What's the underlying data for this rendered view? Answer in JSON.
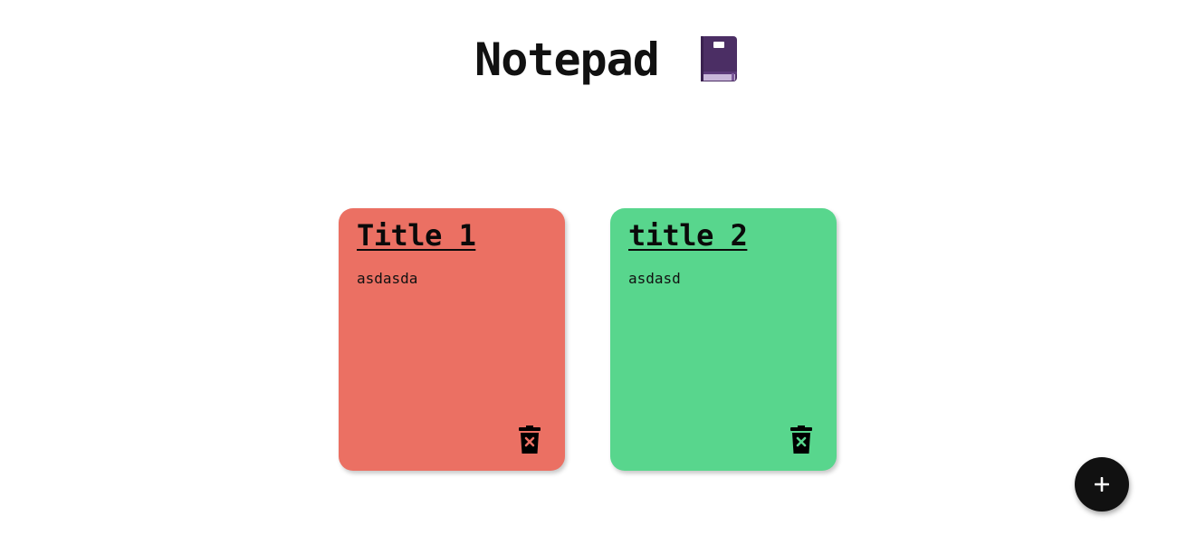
{
  "header": {
    "title": "Notepad",
    "title_icon": "closed-book-icon"
  },
  "notes": [
    {
      "title": "Title 1",
      "body": "asdasda",
      "color": "#EB7063",
      "delete_icon": "trash-delete-icon"
    },
    {
      "title": "title 2",
      "body": "asdasd",
      "color": "#58D68D",
      "delete_icon": "trash-delete-icon"
    }
  ],
  "add_button": {
    "icon": "plus-icon",
    "color": "#111111"
  }
}
